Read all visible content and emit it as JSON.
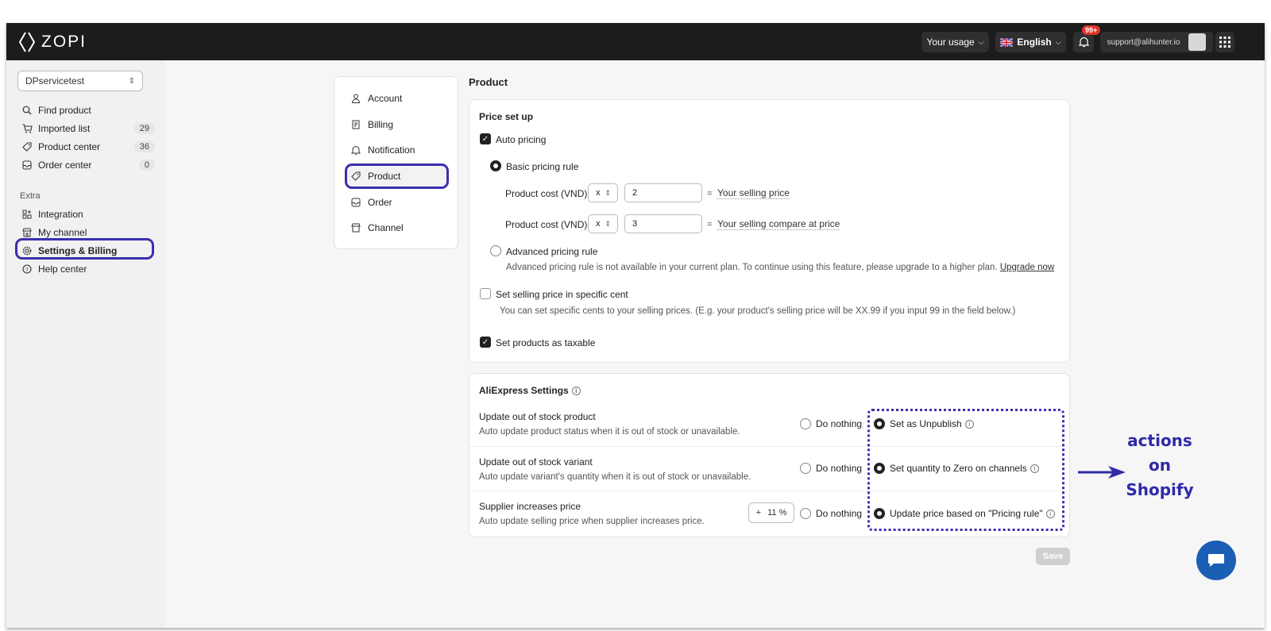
{
  "app": {
    "logo_text": "ZOPI"
  },
  "topbar": {
    "usage_label": "Your usage",
    "language_label": "English",
    "notification_badge": "99+",
    "user_email": "support@alihunter.io"
  },
  "sidebar": {
    "store_select": "DPservicetest",
    "items": [
      {
        "label": "Find product",
        "icon": "search-icon"
      },
      {
        "label": "Imported list",
        "icon": "cart-icon",
        "count": "29"
      },
      {
        "label": "Product center",
        "icon": "tag-icon",
        "count": "36"
      },
      {
        "label": "Order center",
        "icon": "inbox-icon",
        "count": "0"
      }
    ],
    "extra_label": "Extra",
    "extra_items": [
      {
        "label": "Integration",
        "icon": "grid-plus-icon"
      },
      {
        "label": "My channel",
        "icon": "store-icon"
      },
      {
        "label": "Settings & Billing",
        "icon": "gear-icon"
      },
      {
        "label": "Help center",
        "icon": "help-icon"
      }
    ]
  },
  "settings_nav": {
    "items": [
      {
        "label": "Account",
        "icon": "user-icon"
      },
      {
        "label": "Billing",
        "icon": "receipt-icon"
      },
      {
        "label": "Notification",
        "icon": "bell-icon"
      },
      {
        "label": "Product",
        "icon": "tag-icon"
      },
      {
        "label": "Order",
        "icon": "inbox-icon"
      },
      {
        "label": "Channel",
        "icon": "store-icon"
      }
    ]
  },
  "main": {
    "page_title": "Product",
    "price_setup": {
      "title": "Price set up",
      "auto_pricing": "Auto pricing",
      "basic_rule": "Basic pricing rule",
      "row1": {
        "label": "Product cost (VND)",
        "operator": "x",
        "value": "2",
        "eq": "=",
        "result": "Your selling price"
      },
      "row2": {
        "label": "Product cost (VND)",
        "operator": "x",
        "value": "3",
        "eq": "=",
        "result": "Your selling compare at price"
      },
      "advanced_rule": "Advanced pricing rule",
      "advanced_note": "Advanced pricing rule is not available in your current plan. To continue using this feature, please upgrade to a higher plan.",
      "upgrade_link": "Upgrade now",
      "specific_cent": "Set selling price in specific cent",
      "specific_cent_note": "You can set specific cents to your selling prices. (E.g. your product's selling price will be XX.99 if you input 99 in the field below.)",
      "taxable": "Set products as taxable"
    },
    "aliexpress": {
      "title": "AliExpress Settings",
      "rows": [
        {
          "title": "Update out of stock product",
          "desc": "Auto update product status when it is out of stock or unavailable.",
          "opt_off": "Do nothing",
          "opt_on": "Set as Unpublish"
        },
        {
          "title": "Update out of stock variant",
          "desc": "Auto update variant's quantity when it is out of stock or unavailable.",
          "opt_off": "Do nothing",
          "opt_on": "Set quantity to Zero on channels"
        },
        {
          "title": "Supplier increases price",
          "desc": "Auto update selling price when supplier increases price.",
          "opt_off": "Do nothing",
          "opt_on": "Update price based on \"Pricing rule\"",
          "pct_sign": "+",
          "pct_value": "11",
          "pct_unit": "%"
        }
      ]
    },
    "save_label": "Save"
  },
  "annotation": {
    "line1": "actions",
    "line2": "on",
    "line3": "Shopify",
    "color": "#2f2aa8"
  },
  "colors": {
    "topbar": "#1c1c1c",
    "highlight": "#3b2fae",
    "badge": "#e0342a",
    "chat": "#1a5fb4"
  }
}
